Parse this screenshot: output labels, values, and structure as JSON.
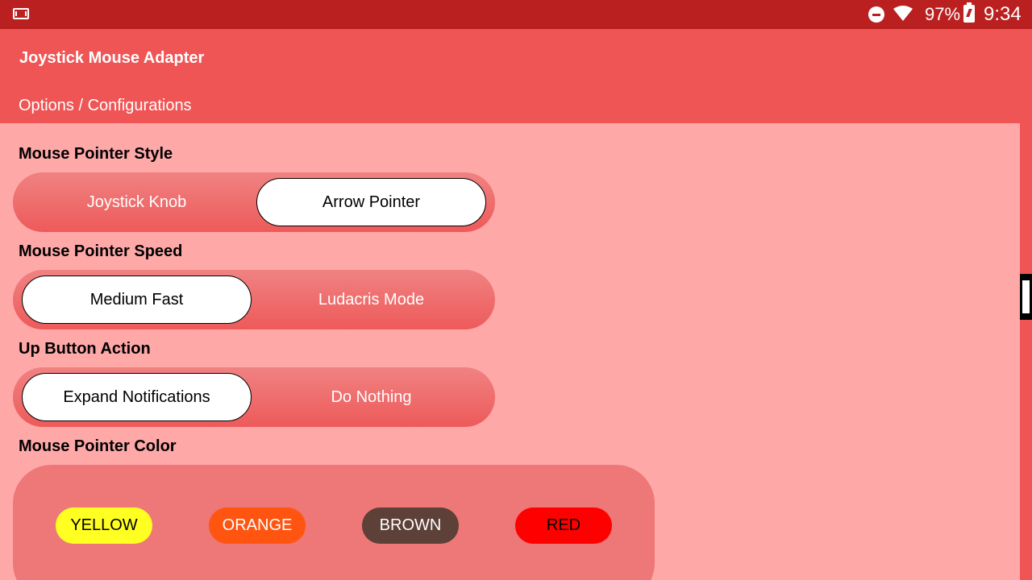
{
  "status_bar": {
    "battery": "97%",
    "time": "9:34"
  },
  "app_bar": {
    "title": "Joystick Mouse Adapter"
  },
  "sub_header": {
    "title": "Options / Configurations"
  },
  "sections": {
    "pointer_style": {
      "label": "Mouse Pointer Style",
      "options": [
        "Joystick Knob",
        "Arrow Pointer"
      ],
      "selected": "Arrow Pointer"
    },
    "pointer_speed": {
      "label": "Mouse Pointer Speed",
      "options": [
        "Medium Fast",
        "Ludacris Mode"
      ],
      "selected": "Medium Fast"
    },
    "up_button_action": {
      "label": "Up Button Action",
      "options": [
        "Expand Notifications",
        "Do Nothing"
      ],
      "selected": "Expand Notifications"
    },
    "pointer_color": {
      "label": "Mouse Pointer Color",
      "colors": [
        {
          "label": "YELLOW",
          "bg": "#ffff22",
          "fg": "#000000"
        },
        {
          "label": "ORANGE",
          "bg": "#ff5511",
          "fg": "#ffffff"
        },
        {
          "label": "BROWN",
          "bg": "#5d4037",
          "fg": "#ffffff"
        },
        {
          "label": "RED",
          "bg": "#ff0000",
          "fg": "#000000"
        }
      ]
    }
  },
  "colors": {
    "status_bar": "#bb2020",
    "app_bar": "#ef5555",
    "background": "#ffa8a8"
  }
}
